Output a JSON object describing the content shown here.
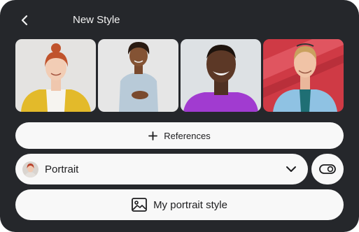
{
  "header": {
    "title": "New Style"
  },
  "references_button": {
    "label": "References",
    "icon": "plus-icon"
  },
  "style_select": {
    "selected": "Portrait",
    "icon": "chevron-down-icon"
  },
  "toggle": {
    "icon": "toggle-icon"
  },
  "saved_style_button": {
    "label": "My portrait style",
    "icon": "image-icon"
  },
  "colors": {
    "panel_bg": "#25272b",
    "pill_bg": "#f8f8f8",
    "text_light": "#f1f1f1",
    "text_dark": "#1d1d1f"
  }
}
